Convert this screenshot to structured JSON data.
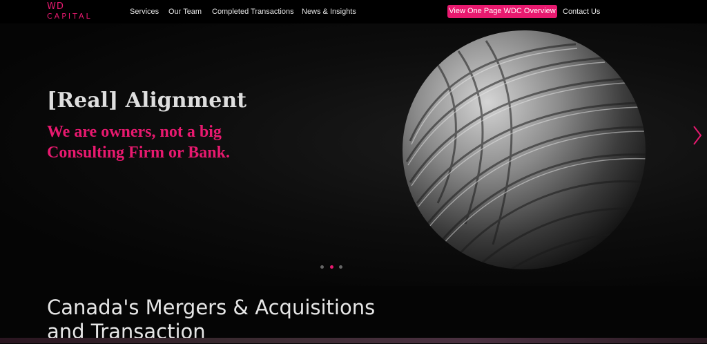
{
  "brand": {
    "logo_line1": "WD",
    "logo_line2": "CAPITAL",
    "accent_color": "#e8196f"
  },
  "nav": {
    "items": [
      {
        "label": "Services"
      },
      {
        "label": "Our Team"
      },
      {
        "label": "Completed Transactions"
      },
      {
        "label": "News & Insights"
      }
    ],
    "cta_label": "View One Page WDC Overview",
    "contact_label": "Contact Us"
  },
  "hero": {
    "title": "[Real] Alignment",
    "subtitle": "We are owners, not a big Consulting Firm or Bank.",
    "slide_count": 3,
    "active_slide": 2,
    "next_icon": "chevron-right-icon"
  },
  "section": {
    "title": "Canada's Mergers & Acquisitions and Transaction"
  }
}
